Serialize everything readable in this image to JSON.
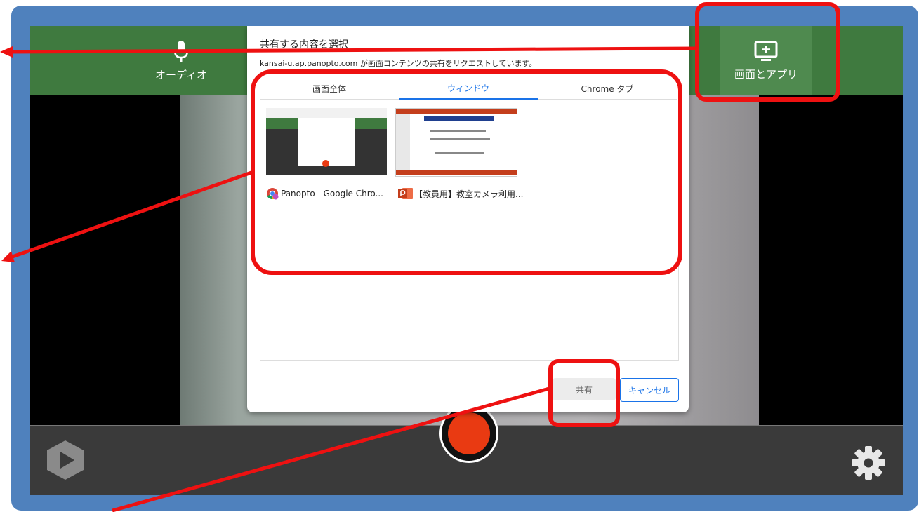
{
  "topbar": {
    "audio_label": "オーディオ",
    "screen_label": "画面とアプリ"
  },
  "dialog": {
    "title": "共有する内容を選択",
    "subtitle": "kansai-u.ap.panopto.com が画面コンテンツの共有をリクエストしています。",
    "tabs": [
      {
        "label": "画面全体",
        "active": false
      },
      {
        "label": "ウィンドウ",
        "active": true
      },
      {
        "label": "Chrome タブ",
        "active": false
      }
    ],
    "windows": [
      {
        "label": "Panopto - Google Chro...",
        "icon": "chrome-icon"
      },
      {
        "label": "【教員用】教室カメラ利用...",
        "icon": "powerpoint-icon"
      }
    ],
    "share_label": "共有",
    "cancel_label": "キャンセル"
  },
  "colors": {
    "frame": "#4f81bd",
    "topbar": "#3f7a3f",
    "highlight": "#ee1111",
    "record": "#e93a12",
    "accent": "#1a73e8"
  }
}
